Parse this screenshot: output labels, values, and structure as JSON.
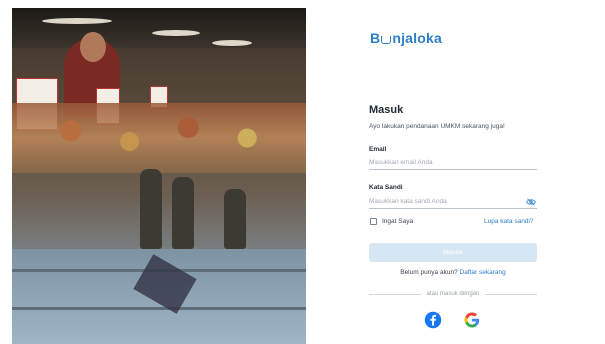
{
  "brand": {
    "logo_prefix": "B",
    "logo_suffix": "njaloka",
    "color": "#2f7fc7"
  },
  "login": {
    "title": "Masuk",
    "subtitle": "Ayo lakukan pendanaan UMKM sekarang juga!",
    "email": {
      "label": "Email",
      "placeholder": "Masukkan email Anda",
      "value": ""
    },
    "password": {
      "label": "Kata Sandi",
      "placeholder": "Masukkan kata sandi Anda",
      "value": ""
    },
    "remember_label": "Ingat Saya",
    "forgot_label": "Lupa kata sandi?",
    "submit_label": "Masuk",
    "register_prompt": "Belum punya akun?",
    "register_link": "Daftar sekarang",
    "divider_text": "atau masuk dengan"
  },
  "social": [
    {
      "icon": "facebook-icon",
      "color": "#1877f2"
    },
    {
      "icon": "google-icon",
      "color": "#4285f4"
    }
  ],
  "colors": {
    "accent": "#2f7fc7",
    "button_disabled": "#d6e6f2"
  }
}
